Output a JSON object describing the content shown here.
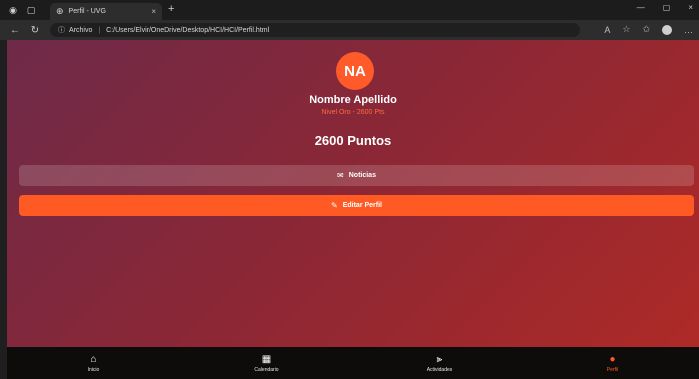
{
  "browser": {
    "tab_title": "Perfil - UVG",
    "tab_close": "×",
    "new_tab": "+",
    "info_icon": "ⓘ",
    "scheme_label": "Archivo",
    "separator": "|",
    "url": "C:/Users/Elvir/OneDrive/Desktop/HCI/HCI/Perfil.html",
    "window_controls": [
      "—",
      "▢",
      "×"
    ]
  },
  "profile": {
    "initials": "NA",
    "name": "Nombre Apellido",
    "level": "Nivel Oro - 2600 Pts",
    "points": "2600 Puntos"
  },
  "actions": {
    "news_label": "Noticias",
    "edit_label": "Editar Perfil"
  },
  "bottom_nav": {
    "items": [
      {
        "label": "Inicio",
        "icon": "home-icon"
      },
      {
        "label": "Calendario",
        "icon": "calendar-icon"
      },
      {
        "label": "Actividades",
        "icon": "dumbbell-icon"
      },
      {
        "label": "Perfil",
        "icon": "user-icon"
      }
    ],
    "active_index": 3
  },
  "colors": {
    "accent": "#ff5a24",
    "gradient_start": "#6e2a49",
    "gradient_end": "#b02a26",
    "nav_bg": "#0e0b0b"
  }
}
